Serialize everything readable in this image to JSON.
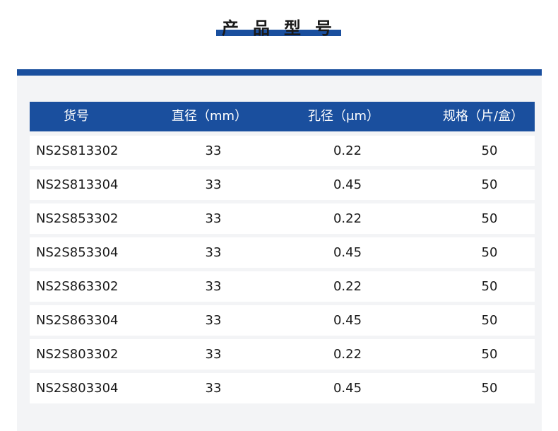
{
  "title": "产品型号",
  "table": {
    "headers": [
      "货号",
      "直径（mm）",
      "孔径（μm）",
      "规格（片/盒）"
    ],
    "rows": [
      [
        "NS2S813302",
        "33",
        "0.22",
        "50"
      ],
      [
        "NS2S813304",
        "33",
        "0.45",
        "50"
      ],
      [
        "NS2S853302",
        "33",
        "0.22",
        "50"
      ],
      [
        "NS2S853304",
        "33",
        "0.45",
        "50"
      ],
      [
        "NS2S863302",
        "33",
        "0.22",
        "50"
      ],
      [
        "NS2S863304",
        "33",
        "0.45",
        "50"
      ],
      [
        "NS2S803302",
        "33",
        "0.22",
        "50"
      ],
      [
        "NS2S803304",
        "33",
        "0.45",
        "50"
      ]
    ]
  },
  "colors": {
    "accent": "#1a4f9e",
    "panel_background": "#f3f4f6",
    "row_background": "#ffffff"
  }
}
